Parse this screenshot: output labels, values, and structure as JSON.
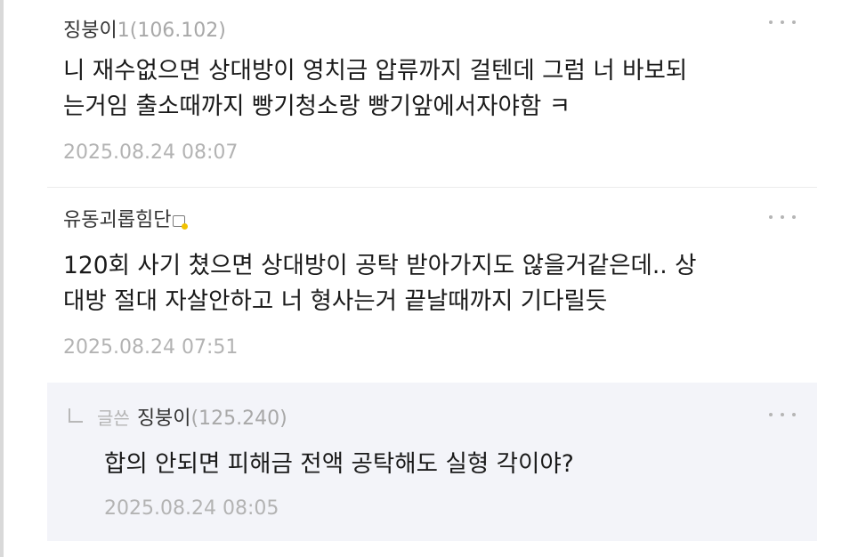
{
  "comments": [
    {
      "nick": "징붕이",
      "suffix": "1",
      "ip": "(106.102)",
      "text": "니 재수없으면 상대방이 영치금 압류까지 걸텐데 그럼 너 바보되\n는거임 출소때까지 빵기청소랑 빵기앞에서자야함 ㅋ",
      "timestamp": "2025.08.24 08:07",
      "more_icon": "more-dots-icon"
    },
    {
      "nick": "유동괴롭힘단",
      "badge_icon": "fixed-nick-badge-icon",
      "text": "120회 사기 쳤으면 상대방이 공탁 받아가지도 않을거같은데.. 상\n대방 절대 자살안하고 너 형사는거 끝날때까지 기다릴듯",
      "timestamp": "2025.08.24 07:51",
      "more_icon": "more-dots-icon"
    },
    {
      "is_reply": true,
      "reply_icon": "reply-arrow-icon",
      "writer_tag": "글쓴",
      "nick": "징붕이",
      "ip": "(125.240)",
      "text": "합의 안되면 피해금 전액 공탁해도 실형 각이야?",
      "timestamp": "2025.08.24 08:05",
      "more_icon": "more-dots-icon"
    }
  ],
  "colors": {
    "reply_background": "#f3f4f9",
    "nick": "#333333",
    "meta_gray": "#a8a8a8",
    "body_text": "#1a1a1a"
  }
}
